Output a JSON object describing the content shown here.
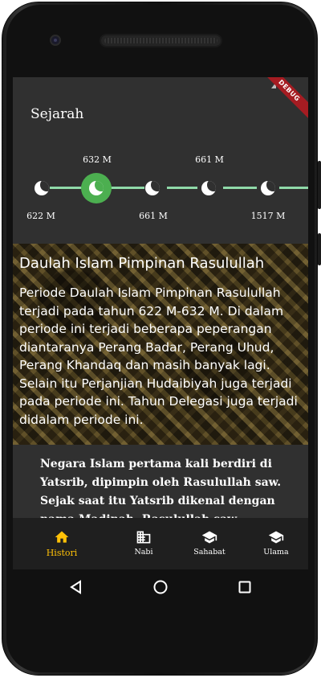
{
  "app": {
    "title": "Sejarah",
    "debug_label": "DEBUG"
  },
  "timeline": {
    "top_labels": [
      "632 M",
      "661 M"
    ],
    "bottom_labels": [
      "622 M",
      "661 M",
      "1517 M"
    ],
    "active_index": 1
  },
  "banner": {
    "title": "Daulah Islam Pimpinan Rasulullah",
    "text": "Periode Daulah Islam Pimpinan Rasulullah terjadi pada tahun 622 M-632 M. Di dalam periode ini terjadi beberapa peperangan diantaranya Perang Badar, Perang Uhud, Perang Khandaq dan masih banyak lagi. Selain itu Perjanjian Hudaibiyah juga terjadi pada periode ini. Tahun Delegasi juga terjadi didalam periode ini."
  },
  "description": "Negara Islam pertama kali berdiri di Yatsrib, dipimpin oleh Rasulullah saw. Sejak saat itu Yatsrib dikenal dengan nama Madinah. Rasulullah saw",
  "bottom_nav": {
    "items": [
      {
        "label": "Histori",
        "icon": "home-icon",
        "active": true
      },
      {
        "label": "Nabi",
        "icon": "building-icon",
        "active": false
      },
      {
        "label": "Sahabat",
        "icon": "school-icon",
        "active": false
      },
      {
        "label": "Ulama",
        "icon": "school-icon",
        "active": false
      }
    ]
  },
  "colors": {
    "accent_active": "#ffc107",
    "timeline_active": "#4caf50",
    "timeline_line": "#8fd9a8",
    "background": "#303030"
  }
}
